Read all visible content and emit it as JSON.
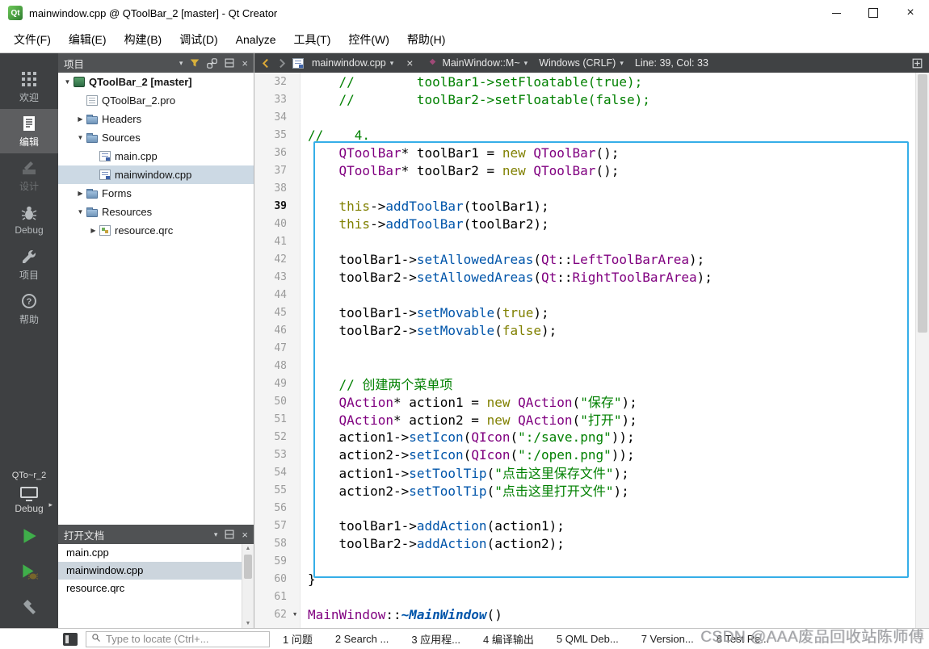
{
  "titlebar": {
    "logo_text": "Qt",
    "title": "mainwindow.cpp @ QToolBar_2 [master] - Qt Creator"
  },
  "menubar": {
    "items": [
      "文件(F)",
      "编辑(E)",
      "构建(B)",
      "调试(D)",
      "Analyze",
      "工具(T)",
      "控件(W)",
      "帮助(H)"
    ]
  },
  "modebar": {
    "modes": [
      {
        "id": "welcome",
        "label": "欢迎",
        "selected": false,
        "disabled": false
      },
      {
        "id": "edit",
        "label": "编辑",
        "selected": true,
        "disabled": false
      },
      {
        "id": "design",
        "label": "设计",
        "selected": false,
        "disabled": true
      },
      {
        "id": "debug",
        "label": "Debug",
        "selected": false,
        "disabled": false
      },
      {
        "id": "projects",
        "label": "项目",
        "selected": false,
        "disabled": false
      },
      {
        "id": "help",
        "label": "帮助",
        "selected": false,
        "disabled": false
      }
    ],
    "target": {
      "project": "QTo~r_2",
      "config": "Debug"
    }
  },
  "projects_panel": {
    "title": "项目",
    "tree": [
      {
        "label": "QToolBar_2 [master]",
        "icon": "project",
        "expand": "open",
        "level": 0,
        "bold": true,
        "selected": false
      },
      {
        "label": "QToolBar_2.pro",
        "icon": "profile",
        "expand": "",
        "level": 1,
        "bold": false,
        "selected": false
      },
      {
        "label": "Headers",
        "icon": "folder",
        "expand": "closed",
        "level": 1,
        "bold": false,
        "selected": false
      },
      {
        "label": "Sources",
        "icon": "folder",
        "expand": "open",
        "level": 1,
        "bold": false,
        "selected": false
      },
      {
        "label": "main.cpp",
        "icon": "cpp",
        "expand": "",
        "level": 2,
        "bold": false,
        "selected": false
      },
      {
        "label": "mainwindow.cpp",
        "icon": "cpp",
        "expand": "",
        "level": 2,
        "bold": false,
        "selected": true
      },
      {
        "label": "Forms",
        "icon": "folder",
        "expand": "closed",
        "level": 1,
        "bold": false,
        "selected": false
      },
      {
        "label": "Resources",
        "icon": "folder",
        "expand": "open",
        "level": 1,
        "bold": false,
        "selected": false
      },
      {
        "label": "resource.qrc",
        "icon": "qrc",
        "expand": "closed",
        "level": 2,
        "bold": false,
        "selected": false
      }
    ]
  },
  "open_documents": {
    "title": "打开文档",
    "items": [
      {
        "label": "main.cpp",
        "selected": false
      },
      {
        "label": "mainwindow.cpp",
        "selected": true
      },
      {
        "label": "resource.qrc",
        "selected": false
      }
    ]
  },
  "editor": {
    "file_name": "mainwindow.cpp",
    "symbol": "MainWindow::M~",
    "line_ending": "Windows (CRLF)",
    "cursor_position": "Line: 39, Col: 33",
    "current_line": 39,
    "lines": [
      {
        "n": 32,
        "fold": false,
        "t": [
          [
            "cm",
            "    //        toolBar1->setFloatable(true);"
          ]
        ]
      },
      {
        "n": 33,
        "fold": false,
        "t": [
          [
            "cm",
            "    //        toolBar2->setFloatable(false);"
          ]
        ]
      },
      {
        "n": 34,
        "fold": false,
        "t": []
      },
      {
        "n": 35,
        "fold": false,
        "t": [
          [
            "cm",
            "//    4."
          ]
        ]
      },
      {
        "n": 36,
        "fold": false,
        "t": [
          [
            "pl",
            "    "
          ],
          [
            "ty",
            "QToolBar"
          ],
          [
            "pl",
            "* toolBar1 = "
          ],
          [
            "kw",
            "new"
          ],
          [
            "pl",
            " "
          ],
          [
            "ty",
            "QToolBar"
          ],
          [
            "pl",
            "();"
          ]
        ]
      },
      {
        "n": 37,
        "fold": false,
        "t": [
          [
            "pl",
            "    "
          ],
          [
            "ty",
            "QToolBar"
          ],
          [
            "pl",
            "* toolBar2 = "
          ],
          [
            "kw",
            "new"
          ],
          [
            "pl",
            " "
          ],
          [
            "ty",
            "QToolBar"
          ],
          [
            "pl",
            "();"
          ]
        ]
      },
      {
        "n": 38,
        "fold": false,
        "t": []
      },
      {
        "n": 39,
        "fold": false,
        "t": [
          [
            "pl",
            "    "
          ],
          [
            "kw",
            "this"
          ],
          [
            "pl",
            "->"
          ],
          [
            "fn",
            "addToolBar"
          ],
          [
            "pl",
            "(toolBar1);"
          ]
        ]
      },
      {
        "n": 40,
        "fold": false,
        "t": [
          [
            "pl",
            "    "
          ],
          [
            "kw",
            "this"
          ],
          [
            "pl",
            "->"
          ],
          [
            "fn",
            "addToolBar"
          ],
          [
            "pl",
            "(toolBar2);"
          ]
        ]
      },
      {
        "n": 41,
        "fold": false,
        "t": []
      },
      {
        "n": 42,
        "fold": false,
        "t": [
          [
            "pl",
            "    toolBar1->"
          ],
          [
            "fn",
            "setAllowedAreas"
          ],
          [
            "pl",
            "("
          ],
          [
            "ty",
            "Qt"
          ],
          [
            "pl",
            "::"
          ],
          [
            "en",
            "LeftToolBarArea"
          ],
          [
            "pl",
            ");"
          ]
        ]
      },
      {
        "n": 43,
        "fold": false,
        "t": [
          [
            "pl",
            "    toolBar2->"
          ],
          [
            "fn",
            "setAllowedAreas"
          ],
          [
            "pl",
            "("
          ],
          [
            "ty",
            "Qt"
          ],
          [
            "pl",
            "::"
          ],
          [
            "en",
            "RightToolBarArea"
          ],
          [
            "pl",
            ");"
          ]
        ]
      },
      {
        "n": 44,
        "fold": false,
        "t": []
      },
      {
        "n": 45,
        "fold": false,
        "t": [
          [
            "pl",
            "    toolBar1->"
          ],
          [
            "fn",
            "setMovable"
          ],
          [
            "pl",
            "("
          ],
          [
            "kw",
            "true"
          ],
          [
            "pl",
            ");"
          ]
        ]
      },
      {
        "n": 46,
        "fold": false,
        "t": [
          [
            "pl",
            "    toolBar2->"
          ],
          [
            "fn",
            "setMovable"
          ],
          [
            "pl",
            "("
          ],
          [
            "kw",
            "false"
          ],
          [
            "pl",
            ");"
          ]
        ]
      },
      {
        "n": 47,
        "fold": false,
        "t": []
      },
      {
        "n": 48,
        "fold": false,
        "t": []
      },
      {
        "n": 49,
        "fold": false,
        "t": [
          [
            "pl",
            "    "
          ],
          [
            "cm",
            "// 创建两个菜单项"
          ]
        ]
      },
      {
        "n": 50,
        "fold": false,
        "t": [
          [
            "pl",
            "    "
          ],
          [
            "ty",
            "QAction"
          ],
          [
            "pl",
            "* action1 = "
          ],
          [
            "kw",
            "new"
          ],
          [
            "pl",
            " "
          ],
          [
            "ty",
            "QAction"
          ],
          [
            "pl",
            "("
          ],
          [
            "st",
            "\"保存\""
          ],
          [
            "pl",
            ");"
          ]
        ]
      },
      {
        "n": 51,
        "fold": false,
        "t": [
          [
            "pl",
            "    "
          ],
          [
            "ty",
            "QAction"
          ],
          [
            "pl",
            "* action2 = "
          ],
          [
            "kw",
            "new"
          ],
          [
            "pl",
            " "
          ],
          [
            "ty",
            "QAction"
          ],
          [
            "pl",
            "("
          ],
          [
            "st",
            "\"打开\""
          ],
          [
            "pl",
            ");"
          ]
        ]
      },
      {
        "n": 52,
        "fold": false,
        "t": [
          [
            "pl",
            "    action1->"
          ],
          [
            "fn",
            "setIcon"
          ],
          [
            "pl",
            "("
          ],
          [
            "ty",
            "QIcon"
          ],
          [
            "pl",
            "("
          ],
          [
            "st",
            "\":/save.png\""
          ],
          [
            "pl",
            "));"
          ]
        ]
      },
      {
        "n": 53,
        "fold": false,
        "t": [
          [
            "pl",
            "    action2->"
          ],
          [
            "fn",
            "setIcon"
          ],
          [
            "pl",
            "("
          ],
          [
            "ty",
            "QIcon"
          ],
          [
            "pl",
            "("
          ],
          [
            "st",
            "\":/open.png\""
          ],
          [
            "pl",
            "));"
          ]
        ]
      },
      {
        "n": 54,
        "fold": false,
        "t": [
          [
            "pl",
            "    action1->"
          ],
          [
            "fn",
            "setToolTip"
          ],
          [
            "pl",
            "("
          ],
          [
            "st",
            "\"点击这里保存文件\""
          ],
          [
            "pl",
            ");"
          ]
        ]
      },
      {
        "n": 55,
        "fold": false,
        "t": [
          [
            "pl",
            "    action2->"
          ],
          [
            "fn",
            "setToolTip"
          ],
          [
            "pl",
            "("
          ],
          [
            "st",
            "\"点击这里打开文件\""
          ],
          [
            "pl",
            ");"
          ]
        ]
      },
      {
        "n": 56,
        "fold": false,
        "t": []
      },
      {
        "n": 57,
        "fold": false,
        "t": [
          [
            "pl",
            "    toolBar1->"
          ],
          [
            "fn",
            "addAction"
          ],
          [
            "pl",
            "(action1);"
          ]
        ]
      },
      {
        "n": 58,
        "fold": false,
        "t": [
          [
            "pl",
            "    toolBar2->"
          ],
          [
            "fn",
            "addAction"
          ],
          [
            "pl",
            "(action2);"
          ]
        ]
      },
      {
        "n": 59,
        "fold": false,
        "t": []
      },
      {
        "n": 60,
        "fold": false,
        "t": [
          [
            "pl",
            "}"
          ]
        ]
      },
      {
        "n": 61,
        "fold": false,
        "t": []
      },
      {
        "n": 62,
        "fold": true,
        "t": [
          [
            "ty",
            "MainWindow"
          ],
          [
            "pl",
            "::"
          ],
          [
            "fnv",
            "~MainWindow"
          ],
          [
            "pl",
            "()"
          ]
        ]
      }
    ]
  },
  "statusbar": {
    "locator_placeholder": "Type to locate (Ctrl+...",
    "panes": [
      "1 问题",
      "2 Search ...",
      "3 应用程...",
      "4 编译输出",
      "5 QML Deb...",
      "7 Version...",
      "8 Test Re..."
    ]
  },
  "watermark": "CSDN @AAA废品回收站陈师傅",
  "colors": {
    "selection_box": "#35aee8",
    "comment": "#008000",
    "keyword": "#808000",
    "type": "#800080",
    "function": "#0055aa",
    "string": "#008000",
    "run_green": "#3fae4a",
    "dark_chrome": "#3e4042"
  }
}
